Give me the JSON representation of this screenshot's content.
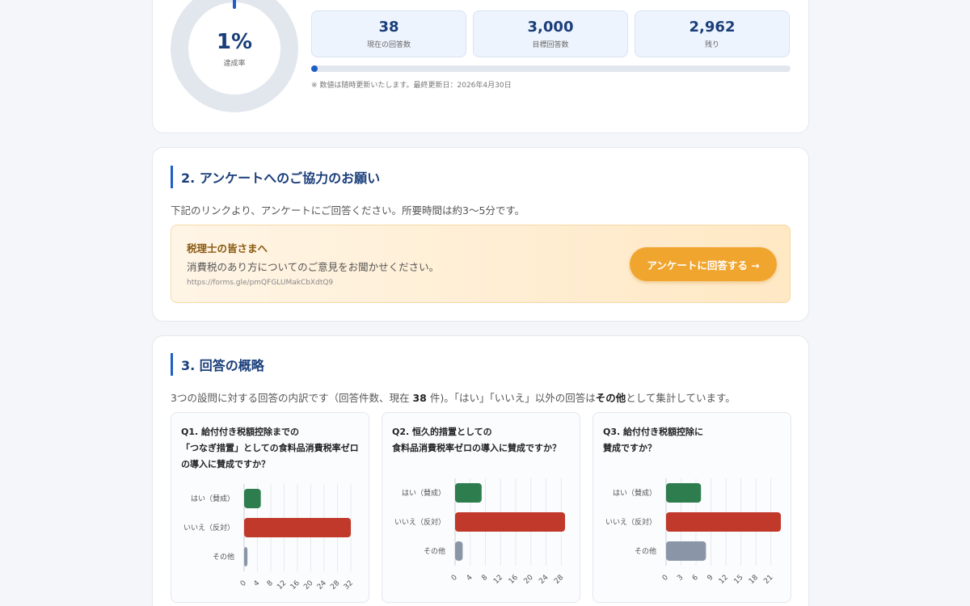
{
  "progress": {
    "percent_label": "1%",
    "percent_caption": "達成率",
    "fraction": 0.0127,
    "stats": [
      {
        "value": "38",
        "label": "現在の回答数"
      },
      {
        "value": "3,000",
        "label": "目標回答数"
      },
      {
        "value": "2,962",
        "label": "残り"
      }
    ],
    "note": "※ 数値は随時更新いたします。最終更新日：2026年4月30日"
  },
  "request": {
    "title": "2. アンケートへのご協力のお願い",
    "description": "下記のリンクより、アンケートにご回答ください。所要時間は約3〜5分です。",
    "cta_heading": "税理士の皆さまへ",
    "cta_text": "消費税のあり方についてのご意見をお聞かせください。",
    "cta_url": "https://forms.gle/pmQFGLUMakCbXdtQ9",
    "cta_button": "アンケートに回答する →"
  },
  "summary": {
    "title": "3. 回答の概略",
    "desc_1": "3つの設問に対する回答の内訳です（回答件数、現在 ",
    "desc_count": "38",
    "desc_2": " 件)。「はい」「いいえ」以外の回答は",
    "desc_bold": "その他",
    "desc_3": "として集計しています。"
  },
  "colors": {
    "yes": "#2e7d4f",
    "no": "#c0392b",
    "other": "#8a96a8",
    "accent": "#1f5fc4"
  },
  "chart_data": [
    {
      "type": "bar",
      "title_lines": [
        "Q1. 給付付き税額控除までの",
        "「つなぎ措置」としての食料品消費税率ゼロ",
        "の導入に賛成ですか？"
      ],
      "categories": [
        "はい（賛成）",
        "いいえ（反対）",
        "その他"
      ],
      "values": [
        5,
        32,
        1
      ],
      "xticks": [
        0,
        4,
        8,
        12,
        16,
        20,
        24,
        28,
        32
      ],
      "xlim": [
        0,
        32
      ]
    },
    {
      "type": "bar",
      "title_lines": [
        "Q2. 恒久的措置としての",
        "食料品消費税率ゼロの導入に賛成ですか？"
      ],
      "categories": [
        "はい（賛成）",
        "いいえ（反対）",
        "その他"
      ],
      "values": [
        7,
        29,
        2
      ],
      "xticks": [
        0,
        4,
        8,
        12,
        16,
        20,
        24,
        28
      ],
      "xlim": [
        0,
        29
      ]
    },
    {
      "type": "bar",
      "title_lines": [
        "Q3. 給付付き税額控除に",
        "賛成ですか？"
      ],
      "categories": [
        "はい（賛成）",
        "いいえ（反対）",
        "その他"
      ],
      "values": [
        7,
        23,
        8
      ],
      "xticks": [
        0,
        3,
        6,
        9,
        12,
        15,
        18,
        21
      ],
      "xlim": [
        0,
        23
      ]
    }
  ]
}
